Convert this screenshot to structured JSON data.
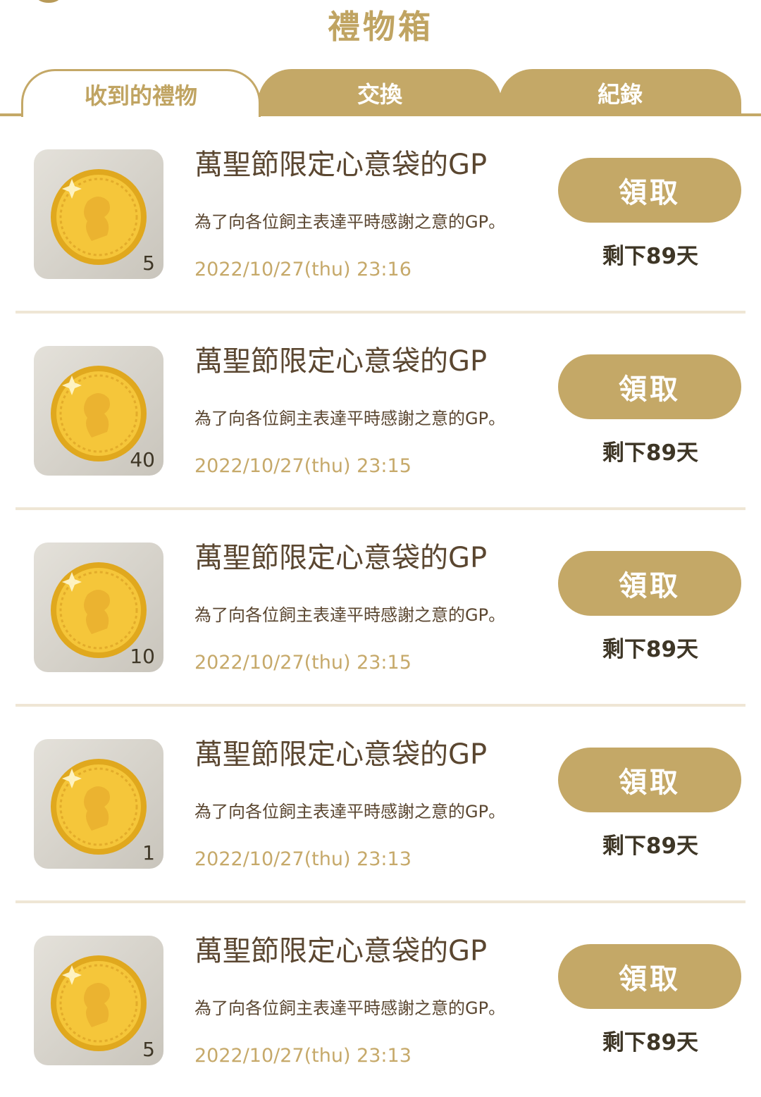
{
  "header": {
    "title": "禮物箱"
  },
  "tabs": [
    {
      "label": "收到的禮物",
      "active": true
    },
    {
      "label": "交換",
      "active": false
    },
    {
      "label": "紀錄",
      "active": false
    }
  ],
  "colors": {
    "accent": "#c4a867",
    "title": "#c0a462",
    "text": "#5a4630",
    "date": "#c6a96a"
  },
  "gifts": [
    {
      "icon": "gold-coin-icon",
      "count": "5",
      "name": "萬聖節限定心意袋的GP",
      "description": "為了向各位飼主表達平時感謝之意的GP。",
      "date": "2022/10/27(thu) 23:16",
      "claim_label": "領取",
      "remaining": "剩下89天"
    },
    {
      "icon": "gold-coin-icon",
      "count": "40",
      "name": "萬聖節限定心意袋的GP",
      "description": "為了向各位飼主表達平時感謝之意的GP。",
      "date": "2022/10/27(thu) 23:15",
      "claim_label": "領取",
      "remaining": "剩下89天"
    },
    {
      "icon": "gold-coin-icon",
      "count": "10",
      "name": "萬聖節限定心意袋的GP",
      "description": "為了向各位飼主表達平時感謝之意的GP。",
      "date": "2022/10/27(thu) 23:15",
      "claim_label": "領取",
      "remaining": "剩下89天"
    },
    {
      "icon": "gold-coin-icon",
      "count": "1",
      "name": "萬聖節限定心意袋的GP",
      "description": "為了向各位飼主表達平時感謝之意的GP。",
      "date": "2022/10/27(thu) 23:13",
      "claim_label": "領取",
      "remaining": "剩下89天"
    },
    {
      "icon": "gold-coin-icon",
      "count": "5",
      "name": "萬聖節限定心意袋的GP",
      "description": "為了向各位飼主表達平時感謝之意的GP。",
      "date": "2022/10/27(thu) 23:13",
      "claim_label": "領取",
      "remaining": "剩下89天"
    }
  ]
}
